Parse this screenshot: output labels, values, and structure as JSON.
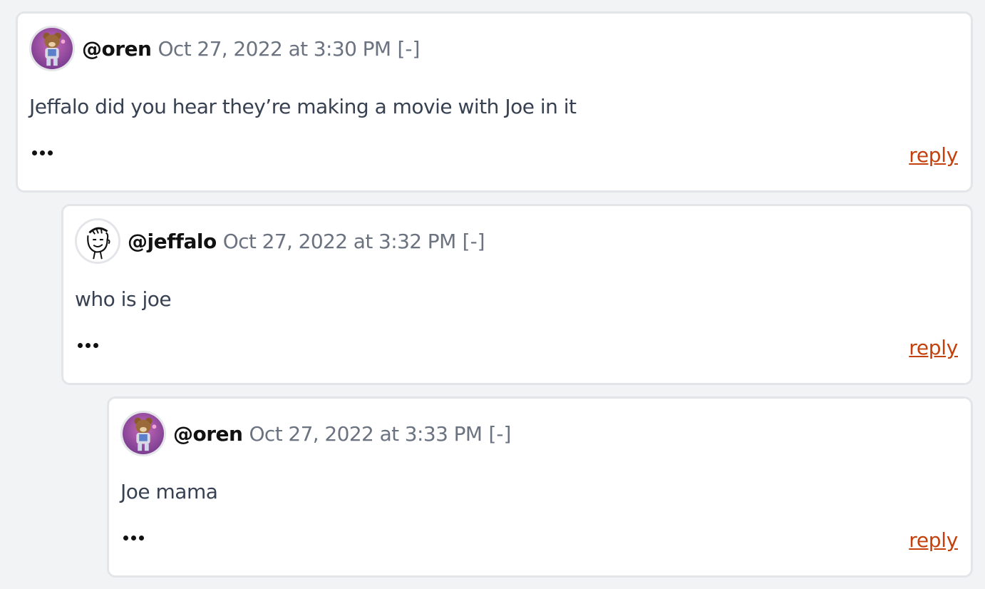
{
  "comments": [
    {
      "username": "@oren",
      "timestamp": "Oct 27, 2022 at 3:30 PM",
      "collapse_label": "[-]",
      "text": "Jeffalo did you hear they’re making a movie with Joe in it",
      "reply_label": "reply",
      "avatar_icon": "bear-avatar-icon"
    },
    {
      "username": "@jeffalo",
      "timestamp": "Oct 27, 2022 at 3:32 PM",
      "collapse_label": "[-]",
      "text": "who is joe",
      "reply_label": "reply",
      "avatar_icon": "cartoon-face-avatar-icon"
    },
    {
      "username": "@oren",
      "timestamp": "Oct 27, 2022 at 3:33 PM",
      "collapse_label": "[-]",
      "text": "Joe mama",
      "reply_label": "reply",
      "avatar_icon": "bear-avatar-icon"
    }
  ],
  "colors": {
    "background": "#f2f3f5",
    "card": "#ffffff",
    "border": "#e3e5e8",
    "muted_text": "#6b7280",
    "reply_link": "#c2410c"
  }
}
